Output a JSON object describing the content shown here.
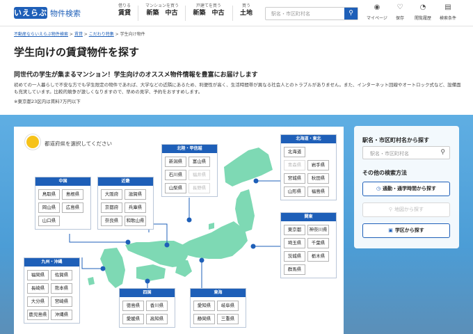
{
  "header": {
    "logo": "いえらぶ",
    "logo_sub": "物件検索",
    "nav": [
      {
        "small": "借りる",
        "main": "賃貸"
      },
      {
        "small": "マンションを買う",
        "main": "新築　中古"
      },
      {
        "small": "戸建てを買う",
        "main": "新築　中古"
      },
      {
        "small": "買う",
        "main": "土地"
      }
    ],
    "search_placeholder": "駅名・市区町村名",
    "icons": [
      {
        "label": "マイページ",
        "icon": "user-icon",
        "glyph": "◉"
      },
      {
        "label": "保存",
        "icon": "bookmark-icon",
        "glyph": "♡"
      },
      {
        "label": "閲覧履歴",
        "icon": "clock-icon",
        "glyph": "◔"
      },
      {
        "label": "検索条件",
        "icon": "clipboard-icon",
        "glyph": "▤"
      }
    ]
  },
  "breadcrumb": {
    "items": [
      "不動産ならいえらぶ物件検索",
      "賃貸",
      "こだわり特集"
    ],
    "current": "学生向け物件",
    "sep": " > "
  },
  "page": {
    "title": "学生向けの賃貸物件を探す",
    "lead": "同世代の学生が集まるマンション！学生向けのオススメ物件情報を豊富にお届けします",
    "desc": "初めての一人暮らしで不安な方でも学生限定の物件であれば、大学などの近隣にあるため、利便性が高く、生活時間帯が異なる社会人とのトラブルがありません。また、インターネット回線やオートロック式など、設備面も充実しています。比較的競争が激しくなりますので、早めの見学、予約をおすすめします。",
    "note": "※東京都23区内は賃料7万円以下"
  },
  "map": {
    "hint": "都道府県を選択してください",
    "regions": {
      "hokkaido_tohoku": {
        "title": "北海道・東北",
        "prefs": [
          [
            "北海道"
          ],
          [
            "青森県",
            "岩手県"
          ],
          [
            "宮城県",
            "秋田県"
          ],
          [
            "山形県",
            "福島県"
          ]
        ],
        "disabled": [
          "青森県"
        ]
      },
      "hokuriku_koshinetsu": {
        "title": "北陸・甲信越",
        "prefs": [
          [
            "新潟県",
            "富山県"
          ],
          [
            "石川県",
            "福井県"
          ],
          [
            "山梨県",
            "長野県"
          ]
        ],
        "disabled": [
          "福井県",
          "長野県"
        ]
      },
      "kanto": {
        "title": "関東",
        "prefs": [
          [
            "東京都",
            "神奈川県"
          ],
          [
            "埼玉県",
            "千葉県"
          ],
          [
            "茨城県",
            "栃木県"
          ],
          [
            "群馬県"
          ]
        ],
        "disabled": []
      },
      "chugoku": {
        "title": "中国",
        "prefs": [
          [
            "鳥取県",
            "島根県"
          ],
          [
            "岡山県",
            "広島県"
          ],
          [
            "山口県"
          ]
        ],
        "disabled": []
      },
      "kinki": {
        "title": "近畿",
        "prefs": [
          [
            "大阪府",
            "滋賀県"
          ],
          [
            "京都府",
            "兵庫県"
          ],
          [
            "奈良県",
            "和歌山県"
          ]
        ],
        "disabled": []
      },
      "kyushu": {
        "title": "九州・沖縄",
        "prefs": [
          [
            "福岡県",
            "佐賀県"
          ],
          [
            "長崎県",
            "熊本県"
          ],
          [
            "大分県",
            "宮崎県"
          ],
          [
            "鹿児島県",
            "沖縄県"
          ]
        ],
        "disabled": []
      },
      "shikoku": {
        "title": "四国",
        "prefs": [
          [
            "徳島県",
            "香川県"
          ],
          [
            "愛媛県",
            "高知県"
          ]
        ],
        "disabled": []
      },
      "tokai": {
        "title": "東海",
        "prefs": [
          [
            "愛知県",
            "岐阜県"
          ],
          [
            "静岡県",
            "三重県"
          ]
        ],
        "disabled": []
      }
    }
  },
  "sidebar": {
    "station_title": "駅名・市区町村名から探す",
    "station_placeholder": "駅名・市区町村名",
    "other_title": "その他の検索方法",
    "buttons": [
      {
        "label": "通勤・通学時間から探す",
        "icon": "commute-icon",
        "glyph": "◷",
        "disabled": false
      },
      {
        "label": "地図から探す",
        "icon": "map-pin-icon",
        "glyph": "⚲",
        "disabled": true
      },
      {
        "label": "学区から探す",
        "icon": "school-icon",
        "glyph": "▣",
        "disabled": false
      }
    ]
  },
  "colors": {
    "brand": "#1e5fb8",
    "land": "#7ed9b4",
    "sky": "#4c9dd6"
  }
}
